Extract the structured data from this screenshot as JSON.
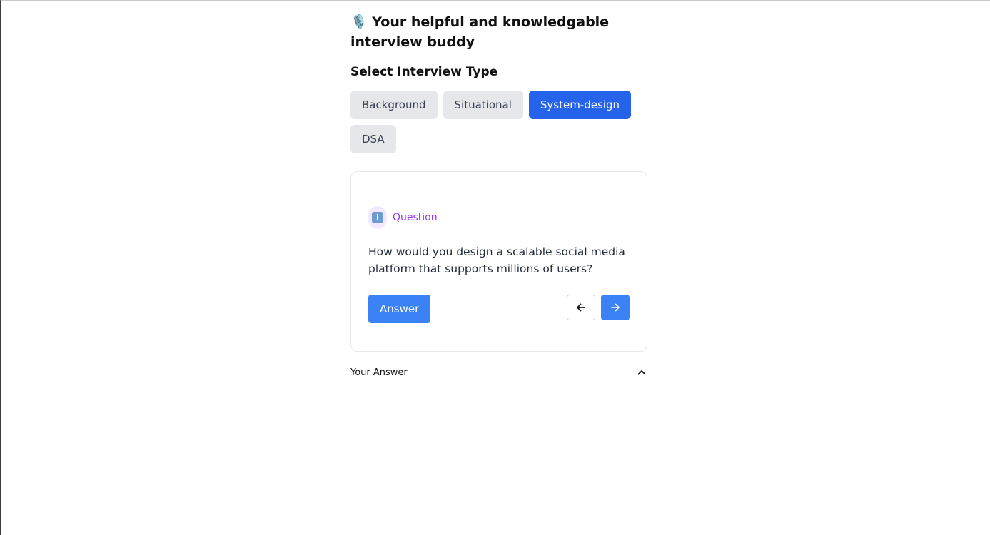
{
  "header": {
    "mic_icon": "🎙️",
    "title": "Your helpful and knowledgable interview buddy"
  },
  "interview_type": {
    "label": "Select Interview Type",
    "options": [
      {
        "label": "Background",
        "selected": false
      },
      {
        "label": "Situational",
        "selected": false
      },
      {
        "label": "System-design",
        "selected": true
      },
      {
        "label": "DSA",
        "selected": false
      }
    ]
  },
  "question_card": {
    "icon": "info-icon",
    "label": "Question",
    "text": "How would you design a scalable social media platform that supports millions of users?",
    "answer_button": "Answer",
    "prev_icon": "arrow-left-icon",
    "next_icon": "arrow-right-icon"
  },
  "your_answer": {
    "label": "Your Answer",
    "toggle_icon": "chevron-up-icon"
  },
  "colors": {
    "accent": "#2563eb",
    "button_blue": "#3b82f6",
    "chip_gray": "#e5e7eb",
    "question_purple": "#9333ea"
  }
}
